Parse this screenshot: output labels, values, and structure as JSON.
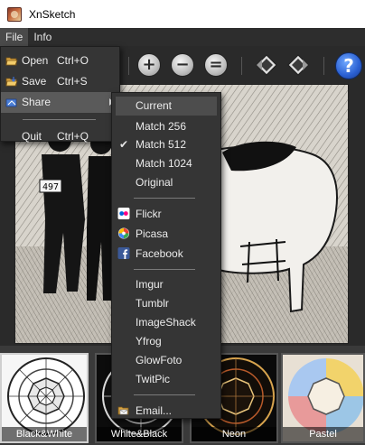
{
  "window": {
    "title": "XnSketch"
  },
  "menubar": {
    "file": "File",
    "info": "Info"
  },
  "file_menu": {
    "open": {
      "label": "Open",
      "shortcut": "Ctrl+O"
    },
    "save": {
      "label": "Save",
      "shortcut": "Ctrl+S"
    },
    "share": {
      "label": "Share"
    },
    "quit": {
      "label": "Quit",
      "shortcut": "Ctrl+Q"
    }
  },
  "share_menu": {
    "sizes": [
      "Current",
      "Match 256",
      "Match 512",
      "Match 1024",
      "Original"
    ],
    "checked": "Match 512",
    "services_a": [
      "Flickr",
      "Picasa",
      "Facebook"
    ],
    "services_b": [
      "Imgur",
      "Tumblr",
      "ImageShack",
      "Yfrog",
      "GlowFoto",
      "TwitPic"
    ],
    "email": "Email..."
  },
  "toolbar": {
    "icons": [
      "zoom-in-icon",
      "zoom-out-icon",
      "zoom-fit-icon",
      "rotate-left-icon",
      "rotate-right-icon",
      "help-icon"
    ],
    "help_glyph": "?"
  },
  "canvas": {
    "bib_number": "497"
  },
  "filters": [
    "Black&White",
    "White&Black",
    "Neon",
    "Pastel"
  ],
  "selected_filter": "Black&White",
  "colors": {
    "menu_bg": "#353535",
    "highlight": "#5a5a5a",
    "accent_blue": "#2a5fd1"
  }
}
